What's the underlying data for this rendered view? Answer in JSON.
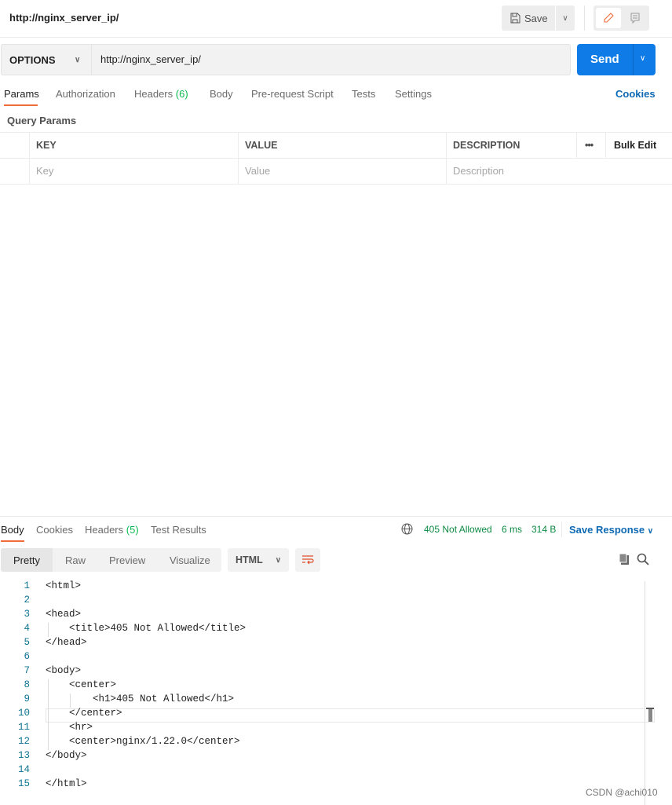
{
  "header": {
    "title": "http://nginx_server_ip/",
    "save_label": "Save"
  },
  "request": {
    "method": "OPTIONS",
    "url": "http://nginx_server_ip/",
    "send_label": "Send"
  },
  "tabs": [
    {
      "label": "Params"
    },
    {
      "label": "Authorization"
    },
    {
      "label": "Headers",
      "count": "(6)"
    },
    {
      "label": "Body"
    },
    {
      "label": "Pre-request Script"
    },
    {
      "label": "Tests"
    },
    {
      "label": "Settings"
    }
  ],
  "cookies_label": "Cookies",
  "params": {
    "title": "Query Params",
    "columns": [
      "KEY",
      "VALUE",
      "DESCRIPTION"
    ],
    "bulk_edit": "Bulk Edit",
    "placeholders": [
      "Key",
      "Value",
      "Description"
    ]
  },
  "response": {
    "tabs": [
      {
        "label": "Body"
      },
      {
        "label": "Cookies"
      },
      {
        "label": "Headers",
        "count": "(5)"
      },
      {
        "label": "Test Results"
      }
    ],
    "status": "405 Not Allowed",
    "time": "6 ms",
    "size": "314 B",
    "save_response": "Save Response",
    "views": [
      "Pretty",
      "Raw",
      "Preview",
      "Visualize"
    ],
    "format": "HTML",
    "lines": [
      "<html>",
      "",
      "<head>",
      "    <title>405 Not Allowed</title>",
      "</head>",
      "",
      "<body>",
      "    <center>",
      "        <h1>405 Not Allowed</h1>",
      "    </center>",
      "    <hr>",
      "    <center>nginx/1.22.0</center>",
      "</body>",
      "",
      "</html>"
    ]
  },
  "watermark": "CSDN @achi010",
  "colors": {
    "accent": "#f26b3a",
    "primary": "#0f7be7",
    "status": "#0b8a42"
  }
}
